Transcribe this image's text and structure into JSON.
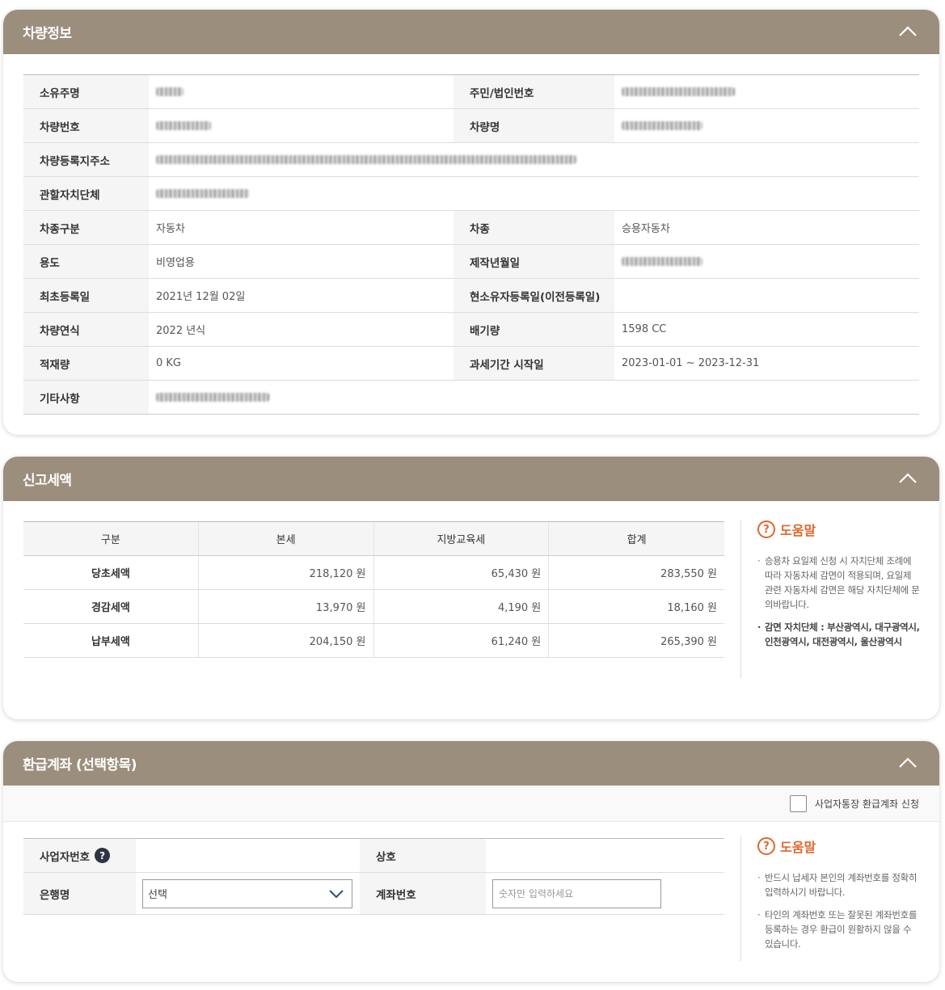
{
  "vehicle_panel": {
    "title": "차량정보",
    "rows": [
      {
        "l1": "소유주명",
        "v1": "",
        "l2": "주민/법인번호",
        "v2": ""
      },
      {
        "l1": "차량번호",
        "v1": "",
        "l2": "차량명",
        "v2": ""
      },
      {
        "l1": "차량등록지주소",
        "v1": ""
      },
      {
        "l1": "관할자치단체",
        "v1": ""
      },
      {
        "l1": "차종구분",
        "v1": "자동차",
        "l2": "차종",
        "v2": "승용자동차"
      },
      {
        "l1": "용도",
        "v1": "비영업용",
        "l2": "제작년월일",
        "v2": ""
      },
      {
        "l1": "최초등록일",
        "v1": "2021년 12월 02일",
        "l2": "현소유자등록일(이전등록일)",
        "v2": ""
      },
      {
        "l1": "차량연식",
        "v1": "2022 년식",
        "l2": "배기량",
        "v2": "1598 CC"
      },
      {
        "l1": "적재량",
        "v1": "0 KG",
        "l2": "과세기간 시작일",
        "v2": "2023-01-01 ~ 2023-12-31"
      },
      {
        "l1": "기타사항",
        "v1": ""
      }
    ]
  },
  "tax_panel": {
    "title": "신고세액",
    "headers": [
      "구분",
      "본세",
      "지방교육세",
      "합계"
    ],
    "rows": [
      {
        "label": "당초세액",
        "base": "218,120 원",
        "edu": "65,430 원",
        "total": "283,550 원"
      },
      {
        "label": "경감세액",
        "base": "13,970 원",
        "edu": "4,190 원",
        "total": "18,160 원"
      },
      {
        "label": "납부세액",
        "base": "204,150 원",
        "edu": "61,240 원",
        "total": "265,390 원"
      }
    ],
    "help": {
      "title": "도움말",
      "items": [
        "승용차 요일제 신청 시 자치단체 조례에 따라 자동차세 감면이 적용되며, 요일제 관련 자동차세 감면은 해당 자치단체에 문의바랍니다.",
        "감면 자치단체 : 부산광역시, 대구광역시, 인천광역시, 대전광역시, 울산광역시"
      ]
    }
  },
  "refund_panel": {
    "title": "환급계좌 (선택항목)",
    "checkbox_label": "사업자통장 환급계좌 신청",
    "business_no_label": "사업자번호",
    "company_label": "상호",
    "bank_label": "은행명",
    "bank_selected": "선택",
    "account_label": "계좌번호",
    "account_placeholder": "숫자만 입력하세요",
    "help": {
      "title": "도움말",
      "items": [
        "반드시 납세자 본인의 계좌번호를 정확히 입력하시기 바랍니다.",
        "타인의 계좌번호 또는 잘못된 계좌번호를 등록하는 경우 환급이 원활하지 않을 수 있습니다."
      ]
    }
  },
  "colors": {
    "header": "#9b8e7c",
    "accent": "#e0662b"
  },
  "icons": {
    "collapse": "chevron-up-icon",
    "help": "question-circle-icon"
  }
}
